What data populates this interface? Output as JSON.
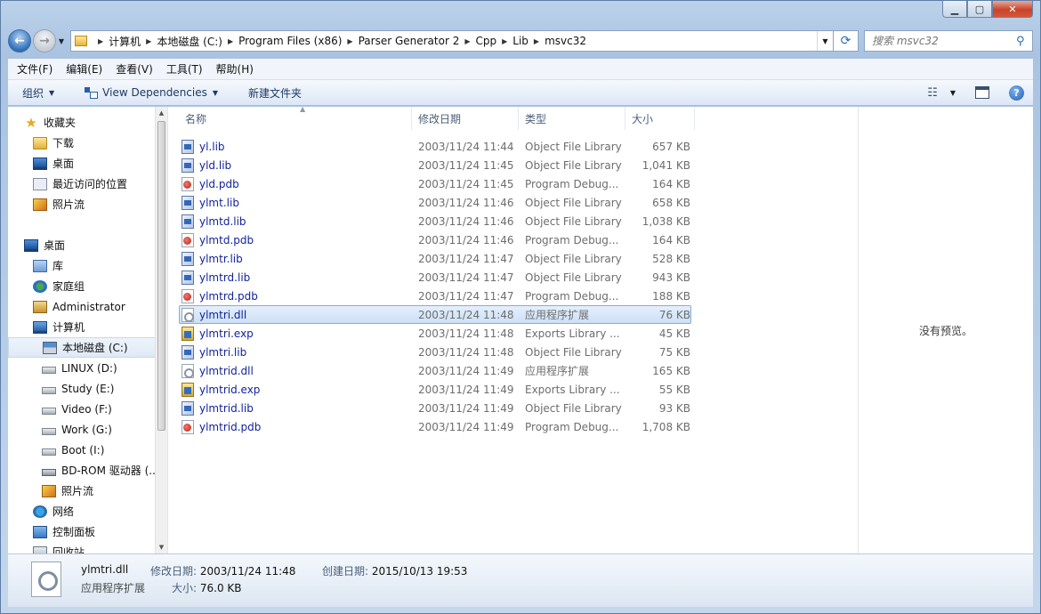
{
  "address": {
    "crumbs": [
      "计算机",
      "本地磁盘 (C:)",
      "Program Files (x86)",
      "Parser Generator 2",
      "Cpp",
      "Lib",
      "msvc32"
    ]
  },
  "search": {
    "placeholder": "搜索 msvc32"
  },
  "menu": [
    "文件(F)",
    "编辑(E)",
    "查看(V)",
    "工具(T)",
    "帮助(H)"
  ],
  "toolbar": {
    "organize": "组织",
    "view_dependencies": "View Dependencies",
    "new_folder": "新建文件夹"
  },
  "nav": {
    "favorites": "收藏夹",
    "downloads": "下载",
    "desktop_fav": "桌面",
    "recent": "最近访问的位置",
    "photo_stream_fav": "照片流",
    "desktop": "桌面",
    "libraries": "库",
    "homegroup": "家庭组",
    "user": "Administrator",
    "computer": "计算机",
    "drive_c": "本地磁盘 (C:)",
    "drive_d": "LINUX (D:)",
    "drive_e": "Study (E:)",
    "drive_f": "Video (F:)",
    "drive_g": "Work (G:)",
    "drive_i": "Boot (I:)",
    "drive_bd": "BD-ROM 驱动器 (...",
    "photo_stream": "照片流",
    "network": "网络",
    "control_panel": "控制面板",
    "recycle_bin": "回收站"
  },
  "columns": {
    "name": "名称",
    "date": "修改日期",
    "type": "类型",
    "size": "大小"
  },
  "files": [
    {
      "name": "yl.lib",
      "date": "2003/11/24 11:44",
      "type": "Object File Library",
      "size": "657 KB",
      "kind": "lib"
    },
    {
      "name": "yld.lib",
      "date": "2003/11/24 11:45",
      "type": "Object File Library",
      "size": "1,041 KB",
      "kind": "lib"
    },
    {
      "name": "yld.pdb",
      "date": "2003/11/24 11:45",
      "type": "Program Debug...",
      "size": "164 KB",
      "kind": "pdb"
    },
    {
      "name": "ylmt.lib",
      "date": "2003/11/24 11:46",
      "type": "Object File Library",
      "size": "658 KB",
      "kind": "lib"
    },
    {
      "name": "ylmtd.lib",
      "date": "2003/11/24 11:46",
      "type": "Object File Library",
      "size": "1,038 KB",
      "kind": "lib"
    },
    {
      "name": "ylmtd.pdb",
      "date": "2003/11/24 11:46",
      "type": "Program Debug...",
      "size": "164 KB",
      "kind": "pdb"
    },
    {
      "name": "ylmtr.lib",
      "date": "2003/11/24 11:47",
      "type": "Object File Library",
      "size": "528 KB",
      "kind": "lib"
    },
    {
      "name": "ylmtrd.lib",
      "date": "2003/11/24 11:47",
      "type": "Object File Library",
      "size": "943 KB",
      "kind": "lib"
    },
    {
      "name": "ylmtrd.pdb",
      "date": "2003/11/24 11:47",
      "type": "Program Debug...",
      "size": "188 KB",
      "kind": "pdb"
    },
    {
      "name": "ylmtri.dll",
      "date": "2003/11/24 11:48",
      "type": "应用程序扩展",
      "size": "76 KB",
      "kind": "dll"
    },
    {
      "name": "ylmtri.exp",
      "date": "2003/11/24 11:48",
      "type": "Exports Library ...",
      "size": "45 KB",
      "kind": "exp"
    },
    {
      "name": "ylmtri.lib",
      "date": "2003/11/24 11:48",
      "type": "Object File Library",
      "size": "75 KB",
      "kind": "lib"
    },
    {
      "name": "ylmtrid.dll",
      "date": "2003/11/24 11:49",
      "type": "应用程序扩展",
      "size": "165 KB",
      "kind": "dll"
    },
    {
      "name": "ylmtrid.exp",
      "date": "2003/11/24 11:49",
      "type": "Exports Library ...",
      "size": "55 KB",
      "kind": "exp"
    },
    {
      "name": "ylmtrid.lib",
      "date": "2003/11/24 11:49",
      "type": "Object File Library",
      "size": "93 KB",
      "kind": "lib"
    },
    {
      "name": "ylmtrid.pdb",
      "date": "2003/11/24 11:49",
      "type": "Program Debug...",
      "size": "1,708 KB",
      "kind": "pdb"
    }
  ],
  "selected_index": 9,
  "preview": {
    "text": "没有预览。"
  },
  "details": {
    "name": "ylmtri.dll",
    "type": "应用程序扩展",
    "modified_label": "修改日期:",
    "modified": "2003/11/24 11:48",
    "created_label": "创建日期:",
    "created": "2015/10/13 19:53",
    "size_label": "大小:",
    "size": "76.0 KB"
  }
}
